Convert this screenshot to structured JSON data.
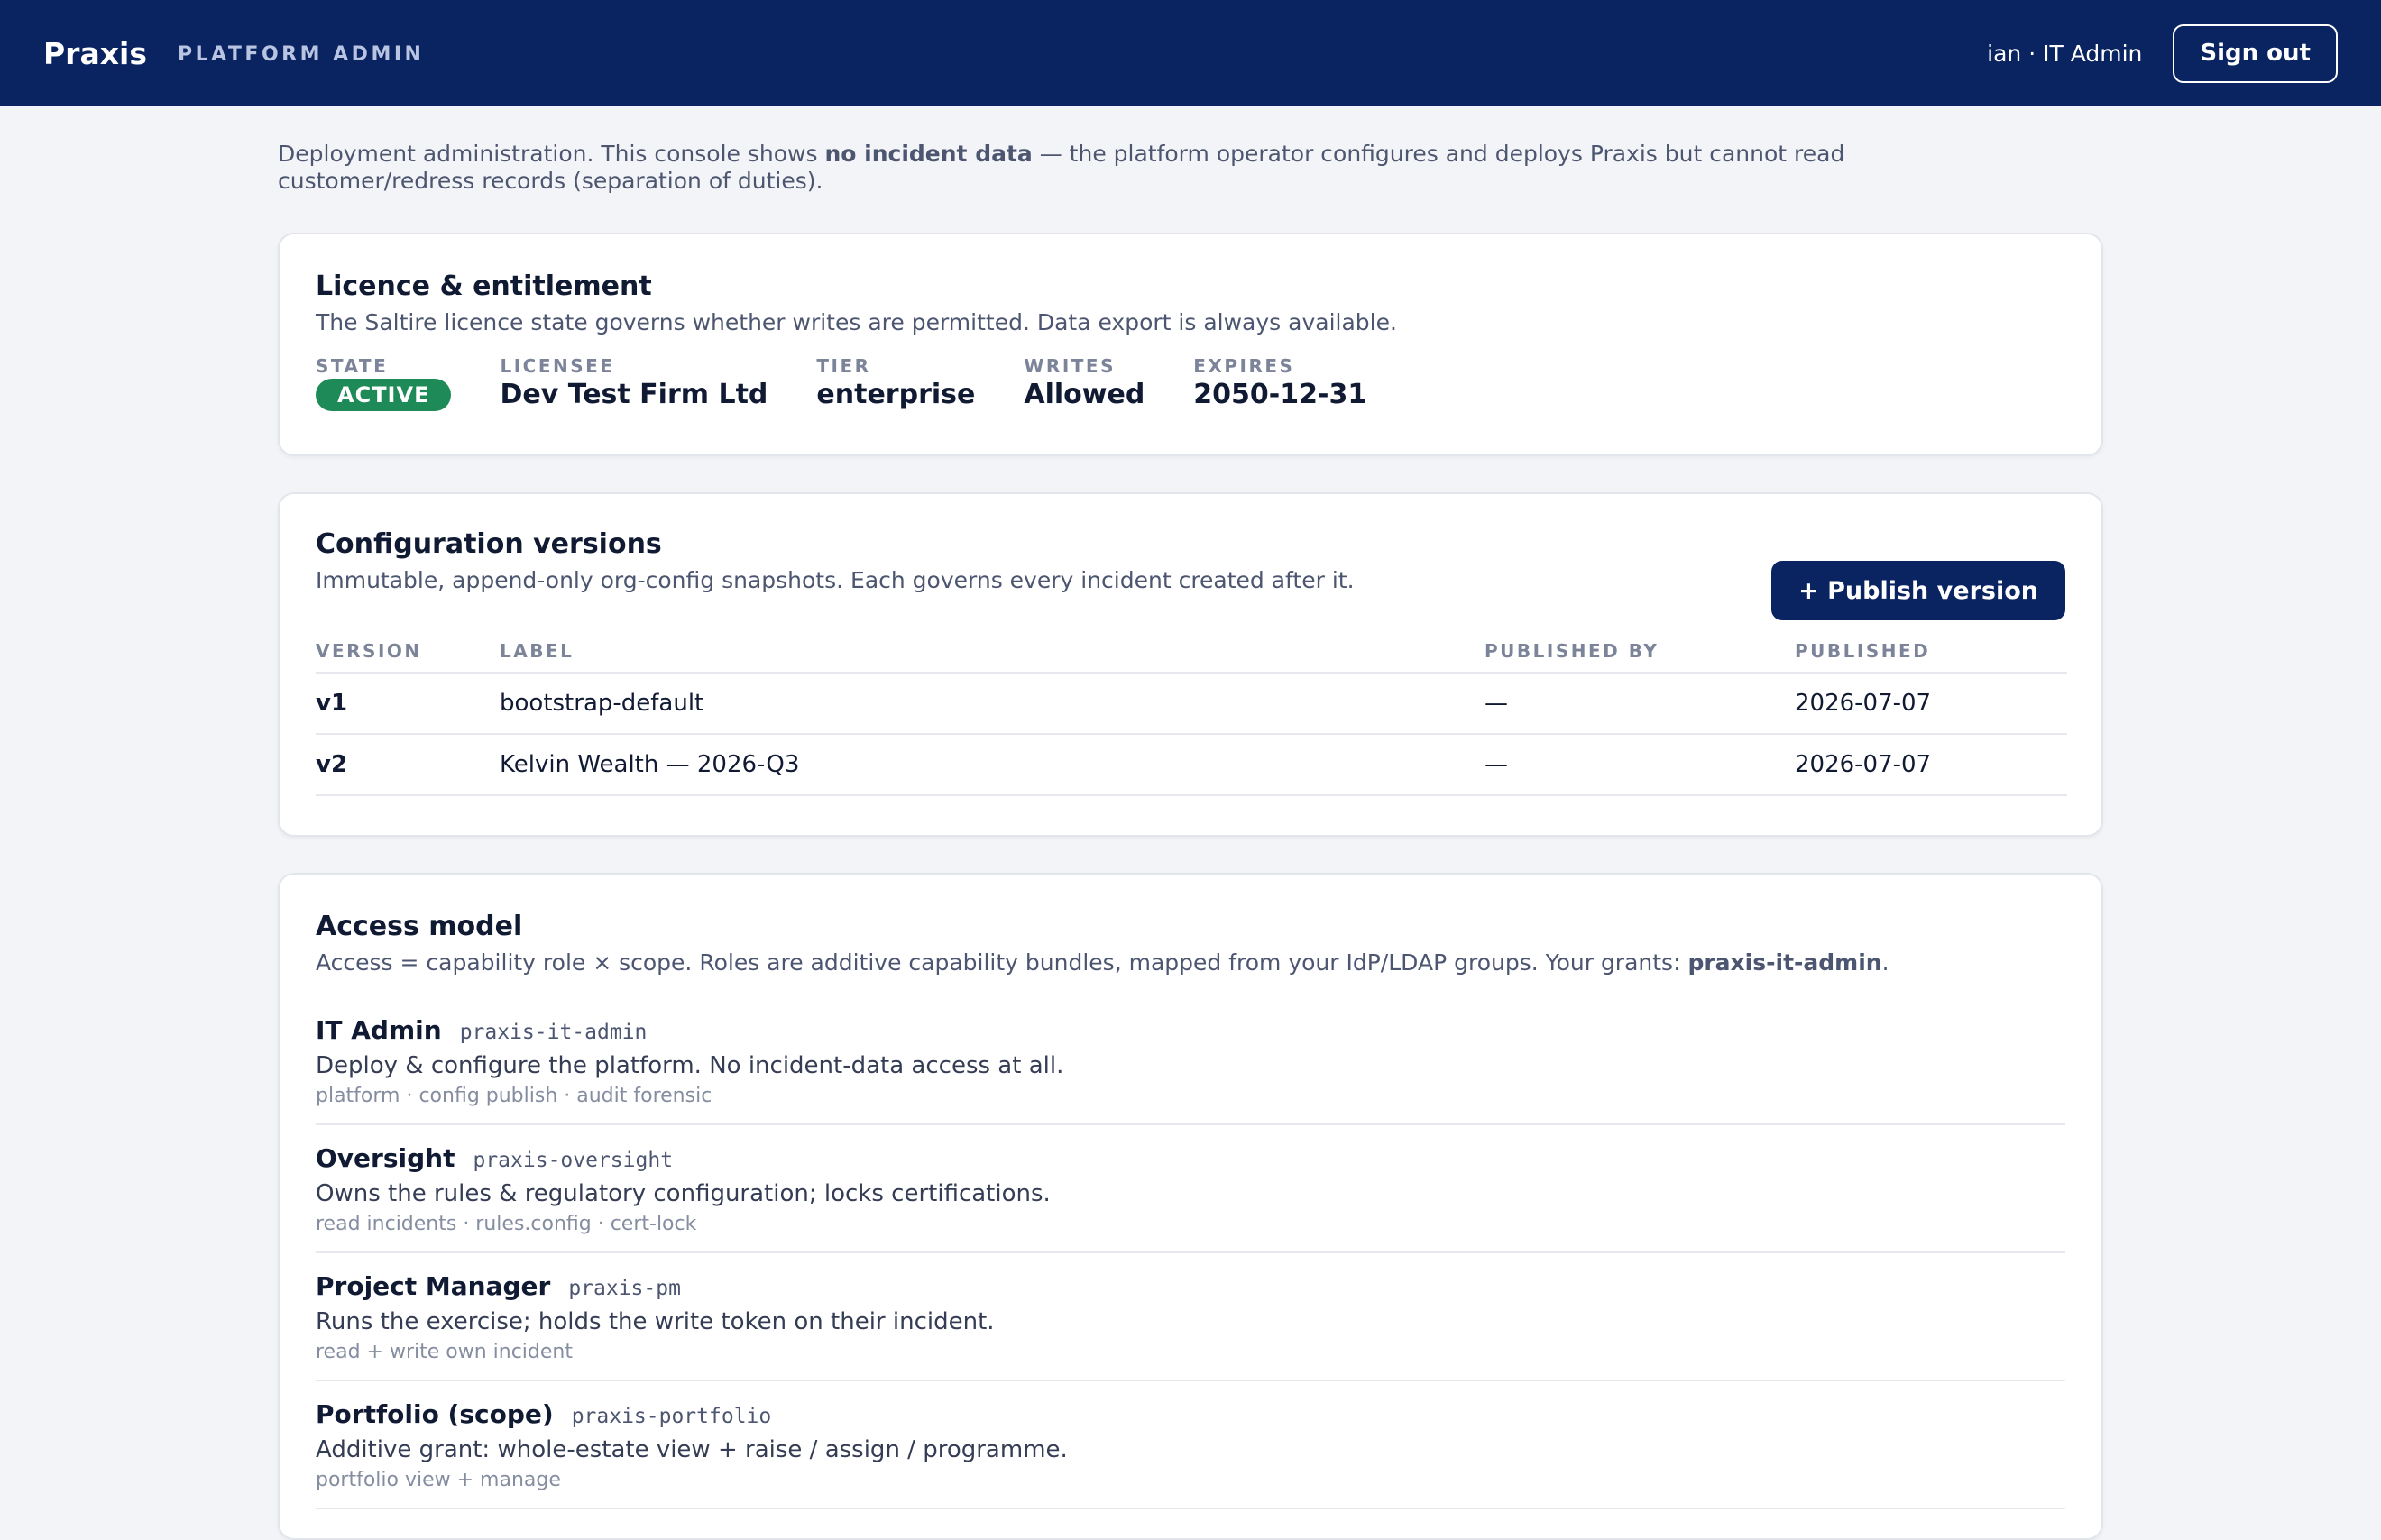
{
  "header": {
    "brand": "Praxis",
    "subtitle": "PLATFORM ADMIN",
    "user": "ian · IT Admin",
    "signout_label": "Sign out",
    "bg_color": "#0a2461"
  },
  "intro": {
    "pre": "Deployment administration. This console shows ",
    "bold": "no incident data",
    "post": " — the platform operator configures and deploys Praxis but cannot read customer/redress records (separation of duties)."
  },
  "licence": {
    "title": "Licence & entitlement",
    "description": "The Saltire licence state governs whether writes are permitted. Data export is always available.",
    "state_label": "STATE",
    "state_value": "ACTIVE",
    "state_color": "#1e8a57",
    "licensee_label": "LICENSEE",
    "licensee_value": "Dev Test Firm Ltd",
    "tier_label": "TIER",
    "tier_value": "enterprise",
    "writes_label": "WRITES",
    "writes_value": "Allowed",
    "expires_label": "EXPIRES",
    "expires_value": "2050-12-31"
  },
  "config": {
    "title": "Configuration versions",
    "description": "Immutable, append-only org-config snapshots. Each governs every incident created after it.",
    "publish_label": "+ Publish version",
    "columns": [
      "VERSION",
      "LABEL",
      "PUBLISHED BY",
      "PUBLISHED"
    ],
    "rows": [
      {
        "version": "v1",
        "label": "bootstrap-default",
        "published_by": "—",
        "published": "2026-07-07"
      },
      {
        "version": "v2",
        "label": "Kelvin Wealth — 2026-Q3",
        "published_by": "—",
        "published": "2026-07-07"
      }
    ]
  },
  "access": {
    "title": "Access model",
    "desc_pre": "Access = capability role × scope. Roles are additive capability bundles, mapped from your IdP/LDAP groups. Your grants: ",
    "desc_bold": "praxis-it-admin",
    "desc_post": ".",
    "roles": [
      {
        "name": "IT Admin",
        "code": "praxis-it-admin",
        "desc": "Deploy & configure the platform. No incident-data access at all.",
        "caps": "platform · config publish · audit forensic"
      },
      {
        "name": "Oversight",
        "code": "praxis-oversight",
        "desc": "Owns the rules & regulatory configuration; locks certifications.",
        "caps": "read incidents · rules.config · cert-lock"
      },
      {
        "name": "Project Manager",
        "code": "praxis-pm",
        "desc": "Runs the exercise; holds the write token on their incident.",
        "caps": "read + write own incident"
      },
      {
        "name": "Portfolio (scope)",
        "code": "praxis-portfolio",
        "desc": "Additive grant: whole-estate view + raise / assign / programme.",
        "caps": "portfolio view + manage"
      }
    ]
  }
}
